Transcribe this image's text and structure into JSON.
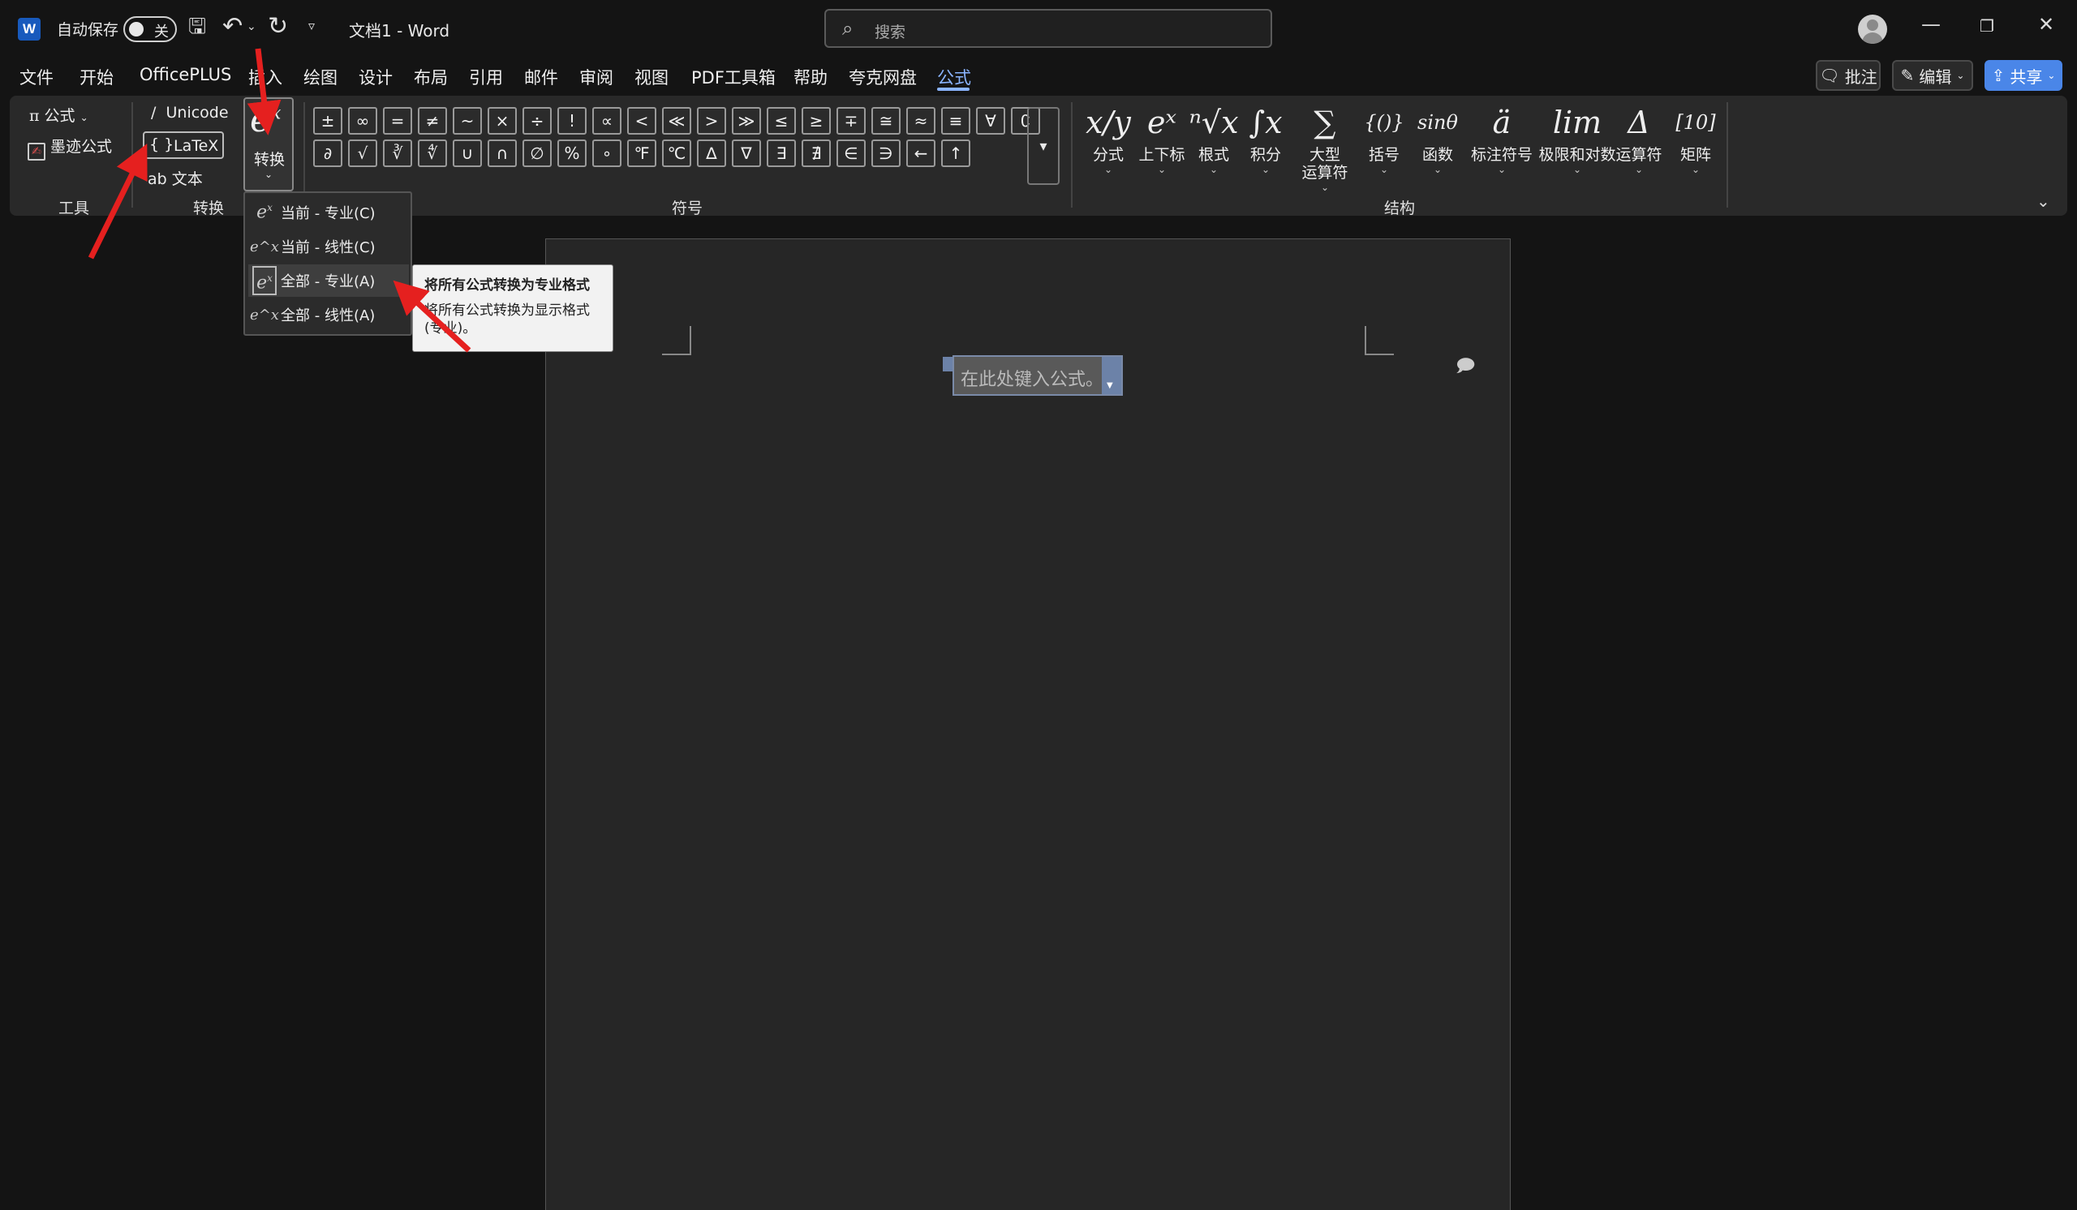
{
  "titlebar": {
    "app_icon": "W",
    "autosave_label": "自动保存",
    "autosave_state": "关",
    "doc_title": "文档1  -  Word",
    "search_placeholder": "搜索",
    "icons": [
      "save-icon",
      "undo-icon",
      "redo-icon",
      "customize-icon",
      "minimize-icon",
      "restore-icon",
      "close-icon"
    ]
  },
  "menu": {
    "tabs": [
      "文件",
      "开始",
      "OfficePLUS",
      "插入",
      "绘图",
      "设计",
      "布局",
      "引用",
      "邮件",
      "审阅",
      "视图",
      "PDF工具箱",
      "帮助",
      "夸克网盘",
      "公式"
    ],
    "active": "公式",
    "comment_btn": "批注",
    "edit_btn": "编辑",
    "share_btn": "共享"
  },
  "ribbon": {
    "tools": {
      "equation": "公式",
      "ink": "墨迹公式",
      "label": "工具"
    },
    "conversions": {
      "unicode": "Unicode",
      "latex": "LaTeX",
      "text": "文本",
      "convert": "转换",
      "label": "转换"
    },
    "symbols": {
      "label": "符号",
      "row1": [
        "±",
        "∞",
        "=",
        "≠",
        "~",
        "×",
        "÷",
        "!",
        "∝",
        "<",
        "≪",
        ">",
        "≫",
        "≤",
        "≥",
        "∓",
        "≅",
        "≈",
        "≡",
        "∀"
      ],
      "row2": [
        "∁",
        "∂",
        "√",
        "∛",
        "∜",
        "∪",
        "∩",
        "∅",
        "%",
        "∘",
        "℉",
        "℃",
        "∆",
        "∇",
        "∃",
        "∄",
        "∈",
        "∋",
        "←",
        "↑"
      ]
    },
    "structures": {
      "label": "结构",
      "items": [
        {
          "glyph": "x/y",
          "label": "分式"
        },
        {
          "glyph": "eˣ",
          "label": "上下标"
        },
        {
          "glyph": "ⁿ√x",
          "label": "根式"
        },
        {
          "glyph": "∫x",
          "label": "积分"
        },
        {
          "glyph": "∑",
          "label": "大型\n运算符"
        },
        {
          "glyph": "{()}",
          "label": "括号"
        },
        {
          "glyph": "sinθ",
          "label": "函数"
        },
        {
          "glyph": "ä",
          "label": "标注符号"
        },
        {
          "glyph": "lim",
          "label": "极限和对数"
        },
        {
          "glyph": "Δ",
          "label": "运算符"
        },
        {
          "glyph": "[10]",
          "label": "矩阵"
        }
      ]
    }
  },
  "dropdown": {
    "items": [
      "当前 - 专业(C)",
      "当前 - 线性(C)",
      "全部 - 专业(A)",
      "全部 - 线性(A)"
    ],
    "highlighted": 2
  },
  "tooltip": {
    "title": "将所有公式转换为专业格式",
    "desc": "将所有公式转换为显示格式(专业)。"
  },
  "document": {
    "equation_placeholder": "在此处键入公式。"
  },
  "colors": {
    "accent": "#8ab4ff",
    "share": "#4a86e8",
    "arrow": "#e5201f"
  }
}
